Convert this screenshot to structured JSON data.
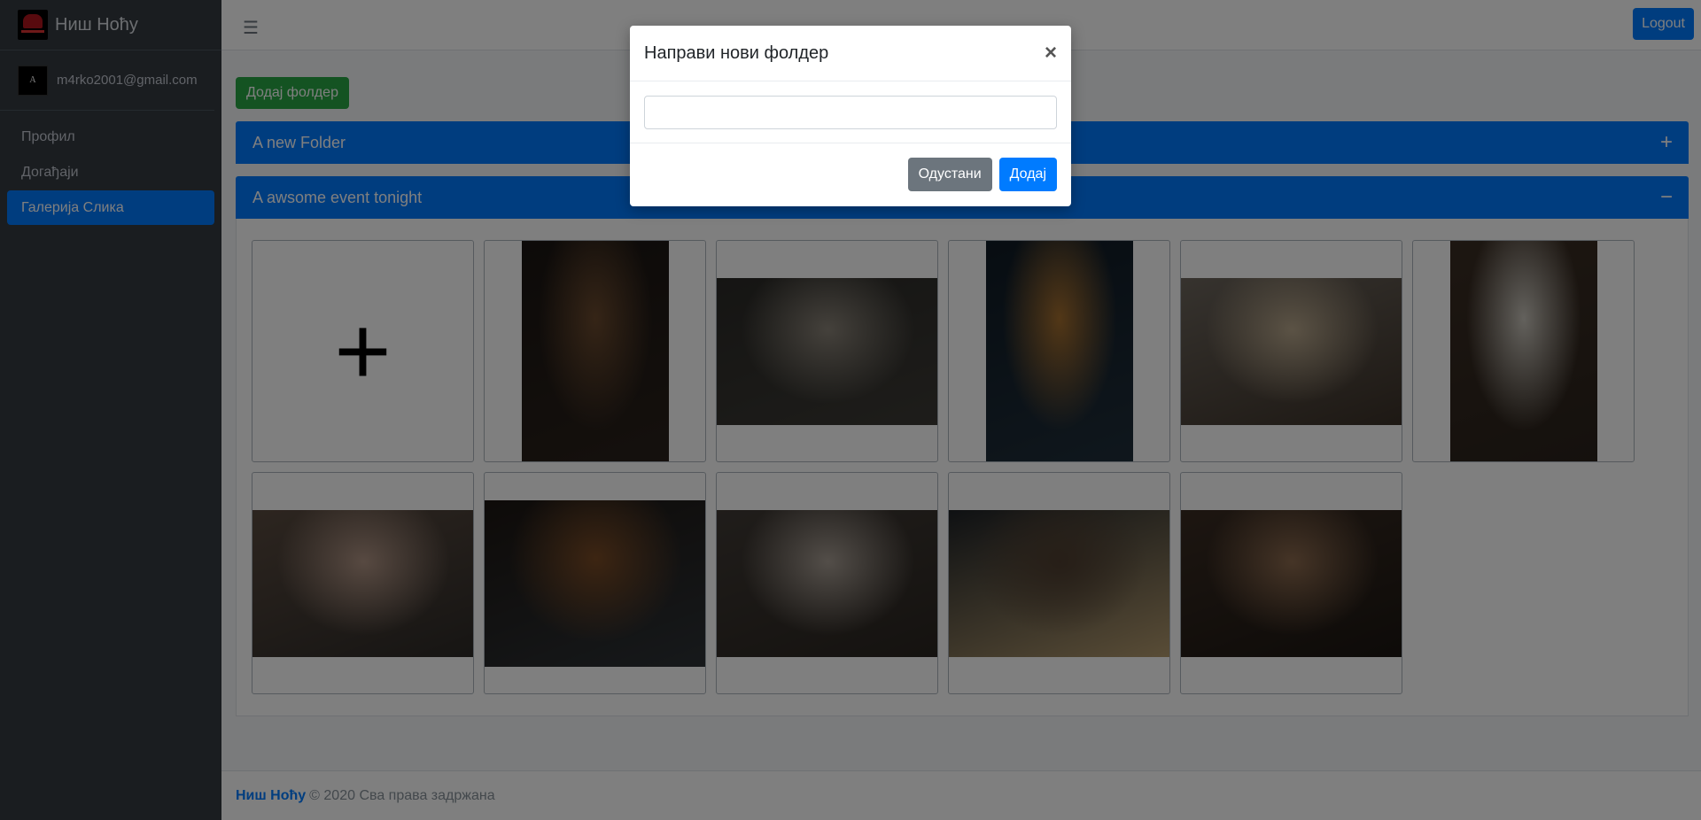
{
  "app": {
    "brand": "Ниш Ноћу"
  },
  "user": {
    "email": "m4rko2001@gmail.com",
    "avatar_letter": "A"
  },
  "sidebar": {
    "items": [
      {
        "label": "Профил",
        "active": false
      },
      {
        "label": "Догађаји",
        "active": false
      },
      {
        "label": "Галерија Слика",
        "active": true
      }
    ]
  },
  "topbar": {
    "menu_icon": "hamburger-icon",
    "logout_label": "Logout"
  },
  "main": {
    "add_folder_label": "Додај фолдер",
    "folders": [
      {
        "title": "A new Folder",
        "toggle": "+",
        "expanded": false
      },
      {
        "title": "A awsome event tonight",
        "toggle": "−",
        "expanded": true
      }
    ],
    "add_photo_symbol": "+",
    "photos": [
      {
        "orientation": "tall",
        "colors": [
          "#1a1512",
          "#6b4a2e",
          "#2a211b"
        ]
      },
      {
        "orientation": "wide",
        "colors": [
          "#2b2a27",
          "#8a8378",
          "#3c3a35"
        ]
      },
      {
        "orientation": "tall",
        "colors": [
          "#0f1a24",
          "#a56f2f",
          "#1f2e3a"
        ]
      },
      {
        "orientation": "wide",
        "colors": [
          "#6d665d",
          "#b7a68b",
          "#3b3128"
        ]
      },
      {
        "orientation": "tall",
        "colors": [
          "#3a2d23",
          "#c7c3ba",
          "#2a221b"
        ]
      },
      {
        "orientation": "wide",
        "colors": [
          "#5a4b40",
          "#b09484",
          "#2d2a27"
        ]
      },
      {
        "orientation": "wide2",
        "colors": [
          "#1c1612",
          "#7a4b25",
          "#2d3236"
        ]
      },
      {
        "orientation": "wide",
        "colors": [
          "#403a35",
          "#a79d93",
          "#2a2520"
        ]
      },
      {
        "orientation": "wide",
        "colors": [
          "#1e2226",
          "#4e3d2f",
          "#b39a6e"
        ]
      },
      {
        "orientation": "wide",
        "colors": [
          "#3a2c22",
          "#8c6a4e",
          "#1b1612"
        ]
      }
    ]
  },
  "footer": {
    "brand": "Ниш Ноћу",
    "text": "© 2020 Сва права задржана"
  },
  "modal": {
    "title": "Направи нови фолдер",
    "close_symbol": "×",
    "input_value": "",
    "cancel_label": "Одустани",
    "submit_label": "Додај"
  }
}
